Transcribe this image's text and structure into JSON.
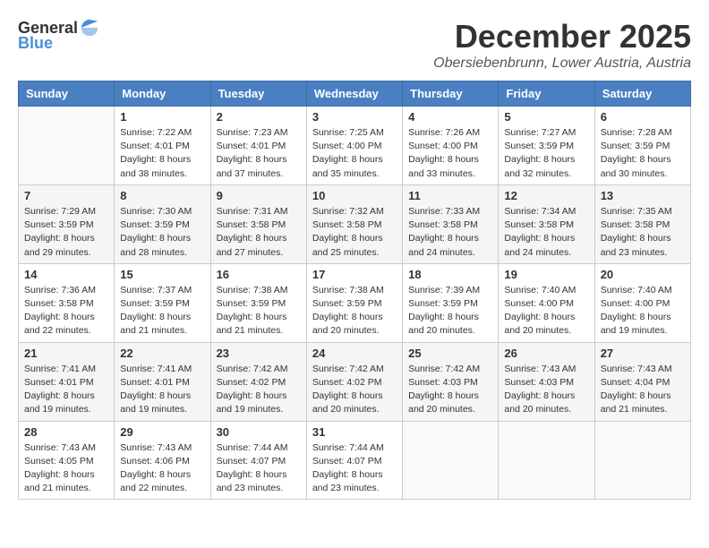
{
  "header": {
    "logo_general": "General",
    "logo_blue": "Blue",
    "month": "December 2025",
    "location": "Obersiebenbrunn, Lower Austria, Austria"
  },
  "days_of_week": [
    "Sunday",
    "Monday",
    "Tuesday",
    "Wednesday",
    "Thursday",
    "Friday",
    "Saturday"
  ],
  "weeks": [
    [
      {
        "day": "",
        "info": ""
      },
      {
        "day": "1",
        "info": "Sunrise: 7:22 AM\nSunset: 4:01 PM\nDaylight: 8 hours\nand 38 minutes."
      },
      {
        "day": "2",
        "info": "Sunrise: 7:23 AM\nSunset: 4:01 PM\nDaylight: 8 hours\nand 37 minutes."
      },
      {
        "day": "3",
        "info": "Sunrise: 7:25 AM\nSunset: 4:00 PM\nDaylight: 8 hours\nand 35 minutes."
      },
      {
        "day": "4",
        "info": "Sunrise: 7:26 AM\nSunset: 4:00 PM\nDaylight: 8 hours\nand 33 minutes."
      },
      {
        "day": "5",
        "info": "Sunrise: 7:27 AM\nSunset: 3:59 PM\nDaylight: 8 hours\nand 32 minutes."
      },
      {
        "day": "6",
        "info": "Sunrise: 7:28 AM\nSunset: 3:59 PM\nDaylight: 8 hours\nand 30 minutes."
      }
    ],
    [
      {
        "day": "7",
        "info": "Sunrise: 7:29 AM\nSunset: 3:59 PM\nDaylight: 8 hours\nand 29 minutes."
      },
      {
        "day": "8",
        "info": "Sunrise: 7:30 AM\nSunset: 3:59 PM\nDaylight: 8 hours\nand 28 minutes."
      },
      {
        "day": "9",
        "info": "Sunrise: 7:31 AM\nSunset: 3:58 PM\nDaylight: 8 hours\nand 27 minutes."
      },
      {
        "day": "10",
        "info": "Sunrise: 7:32 AM\nSunset: 3:58 PM\nDaylight: 8 hours\nand 25 minutes."
      },
      {
        "day": "11",
        "info": "Sunrise: 7:33 AM\nSunset: 3:58 PM\nDaylight: 8 hours\nand 24 minutes."
      },
      {
        "day": "12",
        "info": "Sunrise: 7:34 AM\nSunset: 3:58 PM\nDaylight: 8 hours\nand 24 minutes."
      },
      {
        "day": "13",
        "info": "Sunrise: 7:35 AM\nSunset: 3:58 PM\nDaylight: 8 hours\nand 23 minutes."
      }
    ],
    [
      {
        "day": "14",
        "info": "Sunrise: 7:36 AM\nSunset: 3:58 PM\nDaylight: 8 hours\nand 22 minutes."
      },
      {
        "day": "15",
        "info": "Sunrise: 7:37 AM\nSunset: 3:59 PM\nDaylight: 8 hours\nand 21 minutes."
      },
      {
        "day": "16",
        "info": "Sunrise: 7:38 AM\nSunset: 3:59 PM\nDaylight: 8 hours\nand 21 minutes."
      },
      {
        "day": "17",
        "info": "Sunrise: 7:38 AM\nSunset: 3:59 PM\nDaylight: 8 hours\nand 20 minutes."
      },
      {
        "day": "18",
        "info": "Sunrise: 7:39 AM\nSunset: 3:59 PM\nDaylight: 8 hours\nand 20 minutes."
      },
      {
        "day": "19",
        "info": "Sunrise: 7:40 AM\nSunset: 4:00 PM\nDaylight: 8 hours\nand 20 minutes."
      },
      {
        "day": "20",
        "info": "Sunrise: 7:40 AM\nSunset: 4:00 PM\nDaylight: 8 hours\nand 19 minutes."
      }
    ],
    [
      {
        "day": "21",
        "info": "Sunrise: 7:41 AM\nSunset: 4:01 PM\nDaylight: 8 hours\nand 19 minutes."
      },
      {
        "day": "22",
        "info": "Sunrise: 7:41 AM\nSunset: 4:01 PM\nDaylight: 8 hours\nand 19 minutes."
      },
      {
        "day": "23",
        "info": "Sunrise: 7:42 AM\nSunset: 4:02 PM\nDaylight: 8 hours\nand 19 minutes."
      },
      {
        "day": "24",
        "info": "Sunrise: 7:42 AM\nSunset: 4:02 PM\nDaylight: 8 hours\nand 20 minutes."
      },
      {
        "day": "25",
        "info": "Sunrise: 7:42 AM\nSunset: 4:03 PM\nDaylight: 8 hours\nand 20 minutes."
      },
      {
        "day": "26",
        "info": "Sunrise: 7:43 AM\nSunset: 4:03 PM\nDaylight: 8 hours\nand 20 minutes."
      },
      {
        "day": "27",
        "info": "Sunrise: 7:43 AM\nSunset: 4:04 PM\nDaylight: 8 hours\nand 21 minutes."
      }
    ],
    [
      {
        "day": "28",
        "info": "Sunrise: 7:43 AM\nSunset: 4:05 PM\nDaylight: 8 hours\nand 21 minutes."
      },
      {
        "day": "29",
        "info": "Sunrise: 7:43 AM\nSunset: 4:06 PM\nDaylight: 8 hours\nand 22 minutes."
      },
      {
        "day": "30",
        "info": "Sunrise: 7:44 AM\nSunset: 4:07 PM\nDaylight: 8 hours\nand 23 minutes."
      },
      {
        "day": "31",
        "info": "Sunrise: 7:44 AM\nSunset: 4:07 PM\nDaylight: 8 hours\nand 23 minutes."
      },
      {
        "day": "",
        "info": ""
      },
      {
        "day": "",
        "info": ""
      },
      {
        "day": "",
        "info": ""
      }
    ]
  ]
}
